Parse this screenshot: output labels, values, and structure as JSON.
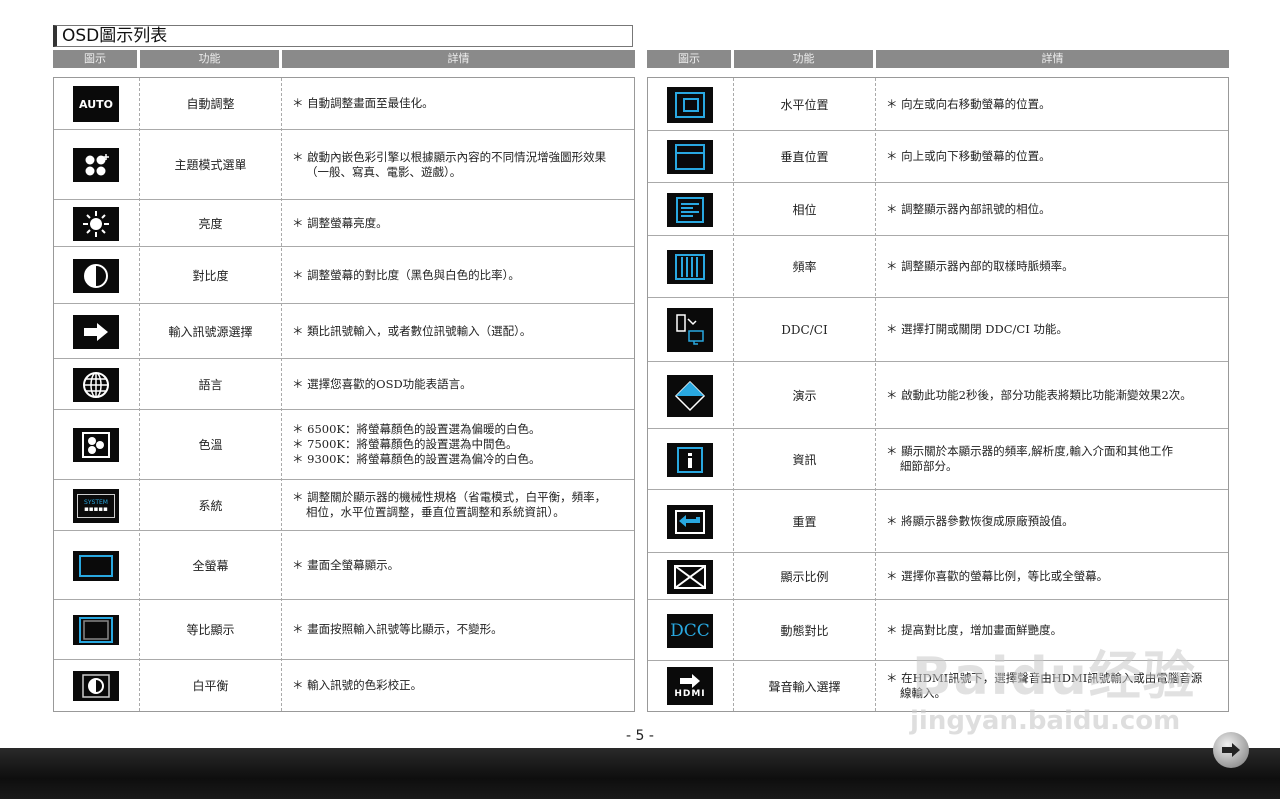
{
  "page_title": "OSD圖示列表",
  "headers": {
    "icon": "圖示",
    "function": "功能",
    "detail": "詳情"
  },
  "left_rows": [
    {
      "icon": "auto-icon",
      "func": "自動調整",
      "detail": [
        "＊ 自動調整畫面至最佳化。"
      ]
    },
    {
      "icon": "theme-mode-icon",
      "func": "主題模式選單",
      "detail": [
        "＊ 啟動內嵌色彩引擎以根據顯示內容的不同情況增強圖形效果",
        "（一般、寫真、電影、遊戲）。"
      ]
    },
    {
      "icon": "brightness-icon",
      "func": "亮度",
      "detail": [
        "＊ 調整螢幕亮度。"
      ]
    },
    {
      "icon": "contrast-icon",
      "func": "對比度",
      "detail": [
        "＊ 調整螢幕的對比度（黑色與白色的比率）。"
      ]
    },
    {
      "icon": "input-select-icon",
      "func": "輸入訊號源選擇",
      "detail": [
        "＊ 類比訊號輸入，或者數位訊號輸入（選配）。"
      ]
    },
    {
      "icon": "language-icon",
      "func": "語言",
      "detail": [
        "＊ 選擇您喜歡的OSD功能表語言。"
      ]
    },
    {
      "icon": "color-temp-icon",
      "func": "色溫",
      "detail": [
        "＊ 6500K：將螢幕顏色的設置選為偏暖的白色。",
        "＊ 7500K：將螢幕顏色的設置選為中間色。",
        "＊ 9300K：將螢幕顏色的設置選為偏冷的白色。"
      ]
    },
    {
      "icon": "system-icon",
      "icon_text": "SYSTEM",
      "func": "系統",
      "detail": [
        "＊ 調整關於顯示器的機械性規格（省電模式，白平衡，頻率，",
        "相位，水平位置調整，垂直位置調整和系統資訊）。"
      ]
    },
    {
      "icon": "full-screen-icon",
      "func": "全螢幕",
      "detail": [
        "＊ 畫面全螢幕顯示。"
      ]
    },
    {
      "icon": "aspect-icon",
      "func": "等比顯示",
      "detail": [
        "＊ 畫面按照輸入訊號等比顯示，不變形。"
      ]
    },
    {
      "icon": "white-balance-icon",
      "func": "白平衡",
      "detail": [
        "＊ 輸入訊號的色彩校正。"
      ]
    }
  ],
  "right_rows": [
    {
      "icon": "h-position-icon",
      "func": "水平位置",
      "detail": [
        "＊ 向左或向右移動螢幕的位置。"
      ]
    },
    {
      "icon": "v-position-icon",
      "func": "垂直位置",
      "detail": [
        "＊ 向上或向下移動螢幕的位置。"
      ]
    },
    {
      "icon": "phase-icon",
      "func": "相位",
      "detail": [
        "＊ 調整顯示器內部訊號的相位。"
      ]
    },
    {
      "icon": "clock-icon",
      "func": "頻率",
      "detail": [
        "＊ 調整顯示器內部的取樣時脈頻率。"
      ]
    },
    {
      "icon": "ddc-ci-icon",
      "func": "DDC/CI",
      "detail": [
        "＊ 選擇打開或關閉 DDC/CI 功能。"
      ]
    },
    {
      "icon": "demo-icon",
      "func": "演示",
      "detail": [
        "＊ 啟動此功能2秒後，部分功能表將類比功能漸變效果2次。"
      ]
    },
    {
      "icon": "info-icon",
      "func": "資訊",
      "detail": [
        "＊ 顯示關於本顯示器的頻率,解析度,輸入介面和其他工作",
        "細節部分。"
      ]
    },
    {
      "icon": "reset-icon",
      "func": "重置",
      "detail": [
        "＊ 將顯示器參數恢復成原廠預設值。"
      ]
    },
    {
      "icon": "display-ratio-icon",
      "func": "顯示比例",
      "detail": [
        "＊ 選擇你喜歡的螢幕比例，等比或全螢幕。"
      ]
    },
    {
      "icon": "dcc-icon",
      "icon_text": "DCC",
      "func": "動態對比",
      "detail": [
        "＊ 提高對比度，增加畫面鮮艷度。"
      ]
    },
    {
      "icon": "hdmi-audio-icon",
      "icon_text": "HDMI",
      "func": "聲音輸入選擇",
      "detail": [
        "＊ 在HDMI訊號下，選擇聲音由HDMI訊號輸入或由電腦音源",
        "線輸入。"
      ]
    }
  ],
  "page_number": "- 5 -",
  "watermark": {
    "logo": "Baidu经验",
    "url": "jingyan.baidu.com"
  },
  "accent_color": "#29a8e0"
}
